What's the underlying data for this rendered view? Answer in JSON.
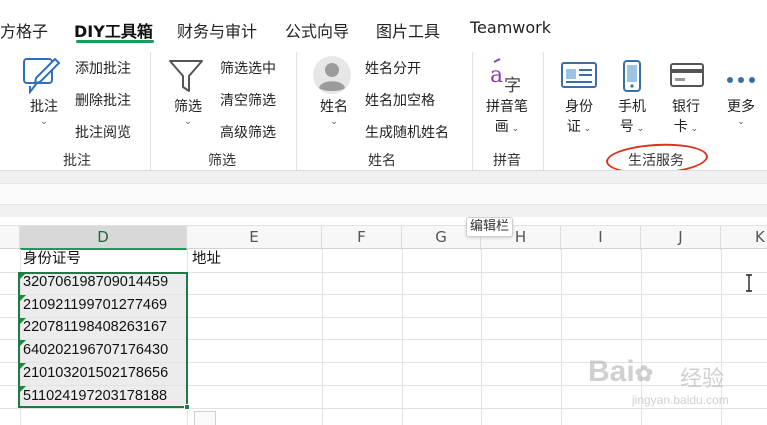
{
  "tabs": [
    "方格子",
    "DIY工具箱",
    "财务与审计",
    "公式向导",
    "图片工具",
    "Teamwork"
  ],
  "ribbon": {
    "pizhu": {
      "label": "批注",
      "buttons": [
        "添加批注",
        "删除批注",
        "批注阅览"
      ],
      "group": "批注"
    },
    "shaixuan": {
      "label": "筛选",
      "buttons": [
        "筛选选中",
        "清空筛选",
        "高级筛选"
      ],
      "group": "筛选"
    },
    "xingming": {
      "label": "姓名",
      "buttons": [
        "姓名分开",
        "姓名加空格",
        "生成随机姓名"
      ],
      "group": "姓名"
    },
    "pinyin": {
      "line1": "拼音笔",
      "line2": "画",
      "group": "拼音",
      "icon_text": "字"
    },
    "life": {
      "group": "生活服务",
      "items": [
        {
          "line1": "身份",
          "line2": "证"
        },
        {
          "line1": "手机",
          "line2": "号"
        },
        {
          "line1": "银行",
          "line2": "卡"
        },
        {
          "line1": "更多",
          "line2": ""
        }
      ]
    },
    "annotation_color": "#e0301e"
  },
  "sheet": {
    "tooltip": "编辑栏",
    "columns": [
      "D",
      "E",
      "F",
      "G",
      "H",
      "I",
      "J",
      "K"
    ],
    "header_d": "身份证号",
    "header_e": "地址",
    "ids": [
      "320706198709014459",
      "210921199701277469",
      "220781198408263167",
      "640202196707176430",
      "210103201502178656",
      "511024197203178188"
    ]
  },
  "watermark": {
    "brand": "Bai",
    "brand2": "经验",
    "url": "jingyan.baidu.com"
  },
  "colors": {
    "accent": "#1a9b5a",
    "selection_border": "#1f7a46"
  }
}
